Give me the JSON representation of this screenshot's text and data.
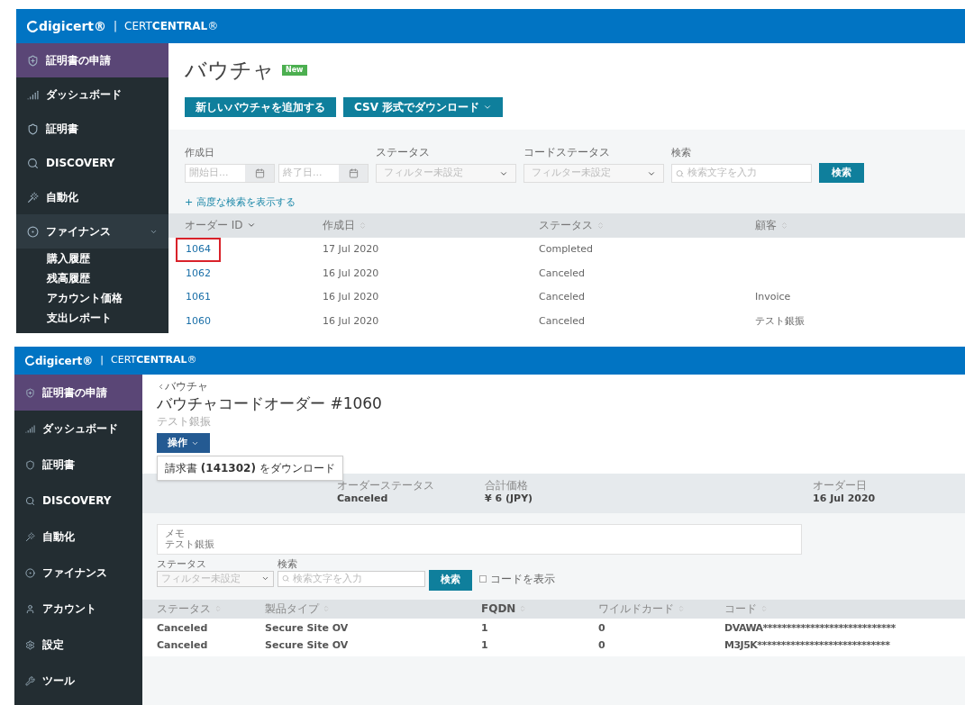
{
  "top_screen": {
    "header": {
      "logo": "digicert®",
      "separator": "|",
      "product": "CERT**CENTRAL**®"
    },
    "sidebar": {
      "items": [
        {
          "label": "証明書の申請",
          "kind": "action",
          "selected": false,
          "expanded": false
        },
        {
          "label": "ダッシュボード",
          "kind": "nav",
          "selected": false,
          "expanded": false
        },
        {
          "label": "証明書",
          "kind": "nav",
          "selected": false,
          "expanded": false
        },
        {
          "label": "DISCOVERY",
          "kind": "nav",
          "selected": false,
          "expanded": false
        },
        {
          "label": "自動化",
          "kind": "nav",
          "selected": false,
          "expanded": false
        },
        {
          "label": "ファイナンス",
          "kind": "nav",
          "selected": true,
          "expanded": true,
          "children": [
            {
              "label": "購入履歴"
            },
            {
              "label": "残高履歴"
            },
            {
              "label": "アカウント価格"
            },
            {
              "label": "支出レポート"
            }
          ]
        }
      ]
    },
    "title": "バウチャ",
    "badge": "New",
    "buttons": [
      {
        "label": "新しいバウチャを追加する",
        "dropdown": false
      },
      {
        "label": "CSV 形式でダウンロード",
        "dropdown": true
      }
    ],
    "filters": {
      "date_label": "作成日",
      "start_placeholder": "開始日...",
      "end_placeholder": "終了日...",
      "status_label": "ステータス",
      "status_value": "フィルター未設定",
      "code_status_label": "コードステータス",
      "code_status_value": "フィルター未設定",
      "search_label": "検索",
      "search_placeholder": "検索文字を入力",
      "search_button": "検索",
      "advanced_link": "+ 高度な検索を表示する"
    },
    "table": {
      "columns": [
        {
          "label": "オーダー ID",
          "sorted": true
        },
        {
          "label": "作成日",
          "sorted": false
        },
        {
          "label": "ステータス",
          "sorted": false
        },
        {
          "label": "顧客",
          "sorted": false
        }
      ],
      "rows": [
        {
          "id": "1064",
          "created": "17 Jul 2020",
          "status": "Completed",
          "highlighted": true
        },
        {
          "id": "1062",
          "created": "16 Jul 2020",
          "status": "Canceled",
          "highlighted": false
        },
        {
          "id": "1061",
          "created": "16 Jul 2020",
          "status": "Canceled",
          "customer": "Invoice",
          "highlighted": false
        },
        {
          "id": "1060",
          "created": "16 Jul 2020",
          "status": "Canceled",
          "customer": "テスト銀振",
          "highlighted": false
        }
      ]
    }
  },
  "bottom_screen": {
    "header": {
      "logo": "digicert®",
      "separator": "|",
      "product": "CERT**CENTRAL**®"
    },
    "sidebar": {
      "items": [
        {
          "label": "証明書の申請",
          "kind": "action",
          "selected": false
        },
        {
          "label": "ダッシュボード",
          "kind": "nav",
          "selected": false
        },
        {
          "label": "証明書",
          "kind": "nav",
          "selected": false
        },
        {
          "label": "DISCOVERY",
          "kind": "nav",
          "selected": false
        },
        {
          "label": "自動化",
          "kind": "nav",
          "selected": false
        },
        {
          "label": "ファイナンス",
          "kind": "nav",
          "selected": false
        },
        {
          "label": "アカウント",
          "kind": "nav",
          "selected": false
        },
        {
          "label": "設定",
          "kind": "nav",
          "selected": false
        },
        {
          "label": "ツール",
          "kind": "nav",
          "selected": false
        }
      ]
    },
    "breadcrumb": "バウチャ",
    "title": "バウチャコードオーダー #1060",
    "subtitle": "テスト銀振",
    "action_button": "操作",
    "menu": {
      "open": true,
      "items": [
        "請求書 **(141302)** をダウンロード"
      ]
    },
    "stats": [
      {
        "label": "オーダーステータス",
        "value": "Canceled"
      },
      {
        "label": "合計価格",
        "value": "¥ 6 (JPY)"
      },
      {
        "label": "オーダー日",
        "value": "16 Jul 2020"
      }
    ],
    "memo": {
      "label": "メモ",
      "text": "テスト銀振"
    },
    "filters": {
      "status_label": "ステータス",
      "status_value": "フィルター未設定",
      "search_label": "検索",
      "search_placeholder": "検索文字を入力",
      "search_button": "検索",
      "show_codes": {
        "label": "コードを表示",
        "checked": false
      }
    },
    "table": {
      "columns": [
        {
          "label": "ステータス",
          "bold": false
        },
        {
          "label": "製品タイプ",
          "bold": false
        },
        {
          "label": "FQDN",
          "bold": true
        },
        {
          "label": "ワイルドカード",
          "bold": false
        },
        {
          "label": "コード",
          "bold": false
        }
      ],
      "rows": [
        [
          "Canceled",
          "Secure Site OV",
          "1",
          "0",
          "DVAWA****************************"
        ],
        [
          "Canceled",
          "Secure Site OV",
          "1",
          "0",
          "M3J5K****************************"
        ]
      ]
    }
  }
}
